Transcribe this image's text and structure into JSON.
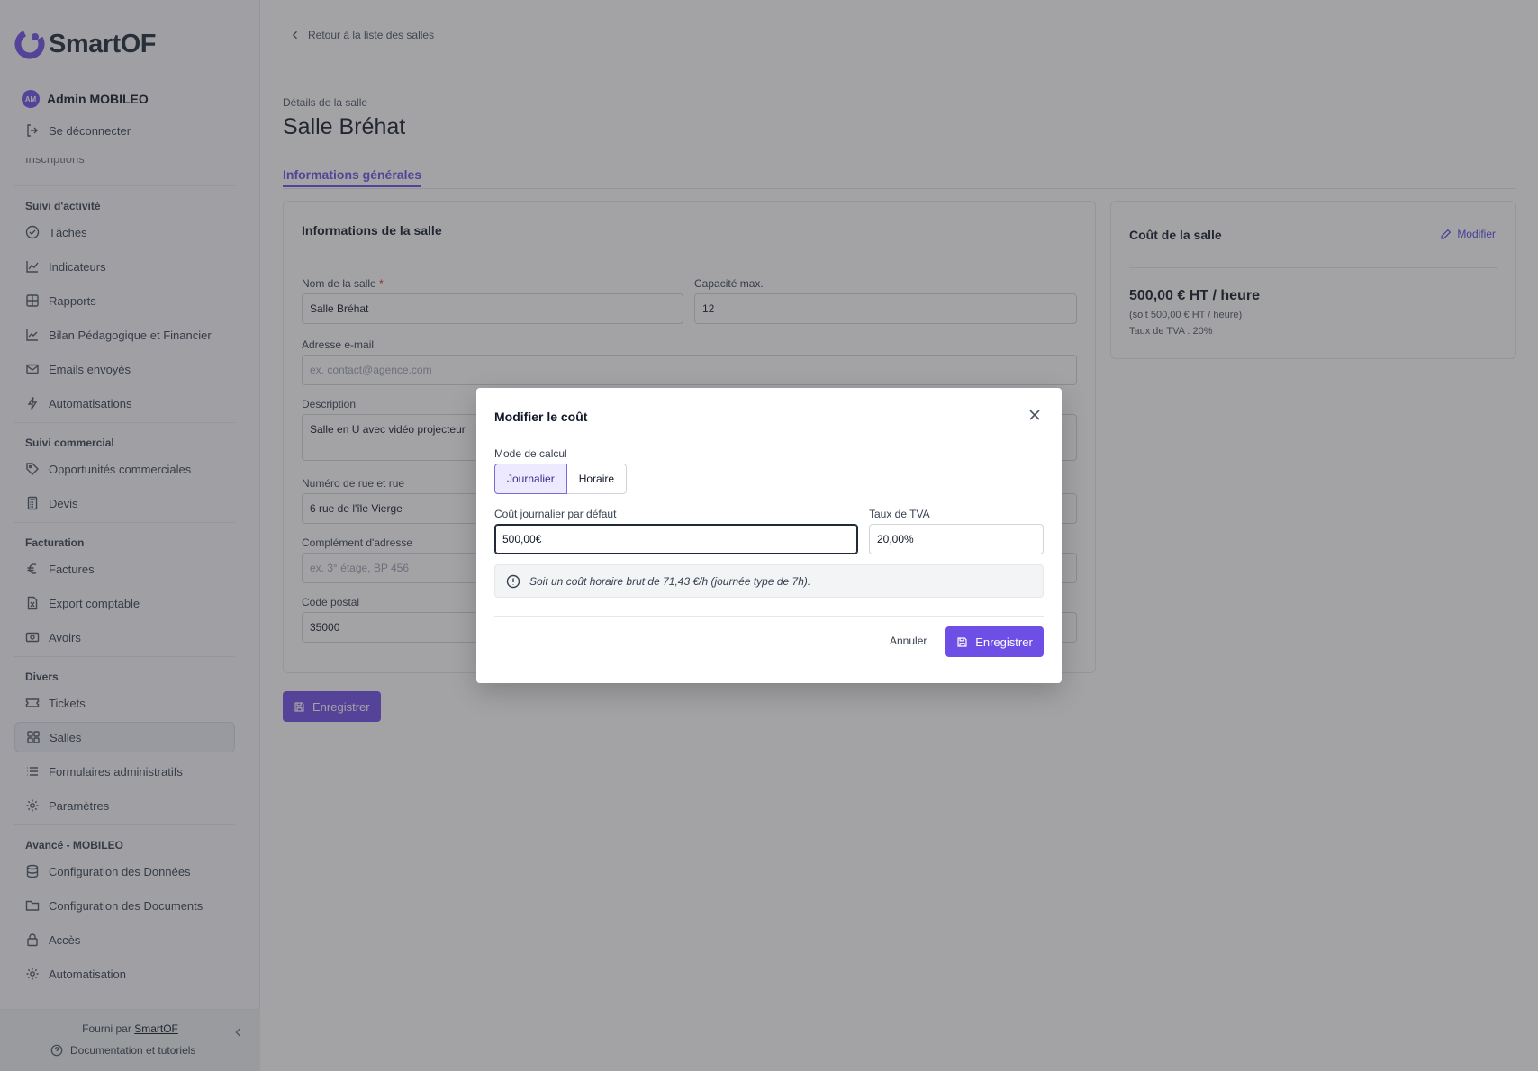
{
  "brand": {
    "name": "SmartOF",
    "accent": "#6d4fe6"
  },
  "user": {
    "initials": "AM",
    "name": "Admin MOBILEO",
    "logout_label": "Se déconnecter"
  },
  "sidebar": {
    "cut_item": "Inscriptions",
    "sections": [
      {
        "title": "Suivi d'activité",
        "items": [
          {
            "label": "Tâches",
            "icon": "check-circle-icon"
          },
          {
            "label": "Indicateurs",
            "icon": "line-chart-icon"
          },
          {
            "label": "Rapports",
            "icon": "table-icon"
          },
          {
            "label": "Bilan Pédagogique et Financier",
            "icon": "trend-chart-icon"
          },
          {
            "label": "Emails envoyés",
            "icon": "mail-icon"
          },
          {
            "label": "Automatisations",
            "icon": "bolt-icon"
          }
        ]
      },
      {
        "title": "Suivi commercial",
        "items": [
          {
            "label": "Opportunités commerciales",
            "icon": "tag-icon"
          },
          {
            "label": "Devis",
            "icon": "calculator-icon"
          }
        ]
      },
      {
        "title": "Facturation",
        "items": [
          {
            "label": "Factures",
            "icon": "euro-icon"
          },
          {
            "label": "Export comptable",
            "icon": "excel-file-icon"
          },
          {
            "label": "Avoirs",
            "icon": "banknote-icon"
          }
        ]
      },
      {
        "title": "Divers",
        "items": [
          {
            "label": "Tickets",
            "icon": "ticket-icon"
          },
          {
            "label": "Salles",
            "icon": "grid-icon",
            "active": true
          },
          {
            "label": "Formulaires administratifs",
            "icon": "list-icon"
          },
          {
            "label": "Paramètres",
            "icon": "gear-icon"
          }
        ]
      },
      {
        "title": "Avancé - MOBILEO",
        "items": [
          {
            "label": "Configuration des Données",
            "icon": "database-icon"
          },
          {
            "label": "Configuration des Documents",
            "icon": "folder-icon"
          },
          {
            "label": "Accès",
            "icon": "lock-icon"
          },
          {
            "label": "Automatisation",
            "icon": "gear-icon"
          }
        ]
      }
    ],
    "footer": {
      "powered_prefix": "Fourni par",
      "powered_link": "SmartOF",
      "docs_label": "Documentation et tutoriels"
    }
  },
  "main": {
    "back_label": "Retour à la liste des salles",
    "subtitle": "Détails de la salle",
    "title": "Salle Bréhat",
    "tab_label": "Informations générales",
    "info_card": {
      "heading": "Informations de la salle",
      "name_label": "Nom de la salle",
      "name_required": "*",
      "name_value": "Salle Bréhat",
      "capacity_label": "Capacité max.",
      "capacity_value": "12",
      "email_label": "Adresse e-mail",
      "email_placeholder": "ex. contact@agence.com",
      "description_label": "Description",
      "description_value": "Salle en U avec vidéo projecteur",
      "street_label": "Numéro de rue et rue",
      "street_value": "6 rue de l'île Vierge",
      "complement_label": "Complément d'adresse",
      "complement_placeholder": "ex. 3° étage, BP 456",
      "postal_label": "Code postal",
      "postal_value": "35000"
    },
    "cost_card": {
      "title": "Coût de la salle",
      "modify_label": "Modifier",
      "main_value": "500,00 € HT / heure",
      "sub_value": "(soit 500,00 € HT / heure)",
      "vat_value": "Taux de TVA : 20%"
    },
    "save_label": "Enregistrer"
  },
  "modal": {
    "title": "Modifier le coût",
    "mode_label": "Mode de calcul",
    "mode_options": [
      "Journalier",
      "Horaire"
    ],
    "mode_selected": "Journalier",
    "daily_cost_label": "Coût journalier par défaut",
    "daily_cost_value": "500,00€",
    "vat_label": "Taux de TVA",
    "vat_value": "20,00%",
    "info_text": "Soit un coût horaire brut de 71,43 €/h (journée type de 7h).",
    "cancel_label": "Annuler",
    "save_label": "Enregistrer"
  }
}
